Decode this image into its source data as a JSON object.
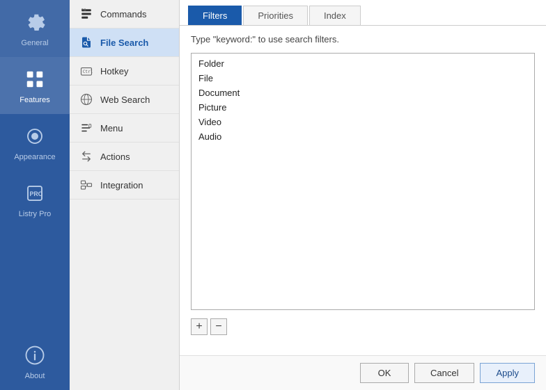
{
  "sidebar": {
    "items": [
      {
        "id": "general",
        "label": "General",
        "active": false
      },
      {
        "id": "features",
        "label": "Features",
        "active": true
      },
      {
        "id": "appearance",
        "label": "Appearance",
        "active": false
      },
      {
        "id": "listry-pro",
        "label": "Listry Pro",
        "active": false,
        "pro": true
      },
      {
        "id": "about",
        "label": "About",
        "active": false
      }
    ]
  },
  "subnav": {
    "items": [
      {
        "id": "commands",
        "label": "Commands"
      },
      {
        "id": "file-search",
        "label": "File Search",
        "active": true
      },
      {
        "id": "hotkey",
        "label": "Hotkey"
      },
      {
        "id": "web-search",
        "label": "Web Search"
      },
      {
        "id": "menu",
        "label": "Menu"
      },
      {
        "id": "actions",
        "label": "Actions"
      },
      {
        "id": "integration",
        "label": "Integration"
      }
    ]
  },
  "tabs": [
    {
      "id": "filters",
      "label": "Filters",
      "active": true
    },
    {
      "id": "priorities",
      "label": "Priorities",
      "active": false
    },
    {
      "id": "index",
      "label": "Index",
      "active": false
    }
  ],
  "content": {
    "hint": "Type \"keyword:\" to use search filters.",
    "filters": [
      "Folder",
      "File",
      "Document",
      "Picture",
      "Video",
      "Audio"
    ],
    "add_btn": "+",
    "remove_btn": "−"
  },
  "footer": {
    "ok_label": "OK",
    "cancel_label": "Cancel",
    "apply_label": "Apply"
  }
}
